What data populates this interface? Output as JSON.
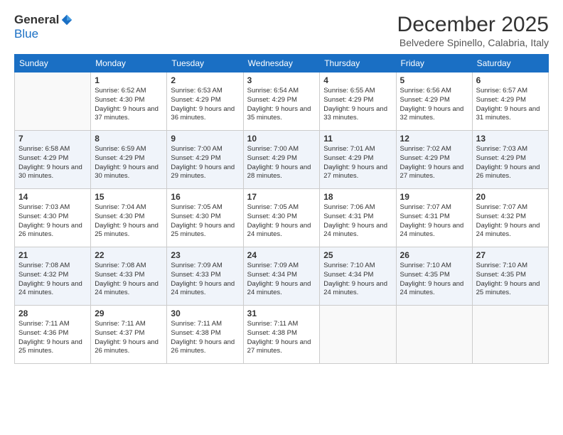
{
  "header": {
    "logo_general": "General",
    "logo_blue": "Blue",
    "month": "December 2025",
    "location": "Belvedere Spinello, Calabria, Italy"
  },
  "weekdays": [
    "Sunday",
    "Monday",
    "Tuesday",
    "Wednesday",
    "Thursday",
    "Friday",
    "Saturday"
  ],
  "weeks": [
    [
      {
        "num": "",
        "sunrise": "",
        "sunset": "",
        "daylight": ""
      },
      {
        "num": "1",
        "sunrise": "Sunrise: 6:52 AM",
        "sunset": "Sunset: 4:30 PM",
        "daylight": "Daylight: 9 hours and 37 minutes."
      },
      {
        "num": "2",
        "sunrise": "Sunrise: 6:53 AM",
        "sunset": "Sunset: 4:29 PM",
        "daylight": "Daylight: 9 hours and 36 minutes."
      },
      {
        "num": "3",
        "sunrise": "Sunrise: 6:54 AM",
        "sunset": "Sunset: 4:29 PM",
        "daylight": "Daylight: 9 hours and 35 minutes."
      },
      {
        "num": "4",
        "sunrise": "Sunrise: 6:55 AM",
        "sunset": "Sunset: 4:29 PM",
        "daylight": "Daylight: 9 hours and 33 minutes."
      },
      {
        "num": "5",
        "sunrise": "Sunrise: 6:56 AM",
        "sunset": "Sunset: 4:29 PM",
        "daylight": "Daylight: 9 hours and 32 minutes."
      },
      {
        "num": "6",
        "sunrise": "Sunrise: 6:57 AM",
        "sunset": "Sunset: 4:29 PM",
        "daylight": "Daylight: 9 hours and 31 minutes."
      }
    ],
    [
      {
        "num": "7",
        "sunrise": "Sunrise: 6:58 AM",
        "sunset": "Sunset: 4:29 PM",
        "daylight": "Daylight: 9 hours and 30 minutes."
      },
      {
        "num": "8",
        "sunrise": "Sunrise: 6:59 AM",
        "sunset": "Sunset: 4:29 PM",
        "daylight": "Daylight: 9 hours and 30 minutes."
      },
      {
        "num": "9",
        "sunrise": "Sunrise: 7:00 AM",
        "sunset": "Sunset: 4:29 PM",
        "daylight": "Daylight: 9 hours and 29 minutes."
      },
      {
        "num": "10",
        "sunrise": "Sunrise: 7:00 AM",
        "sunset": "Sunset: 4:29 PM",
        "daylight": "Daylight: 9 hours and 28 minutes."
      },
      {
        "num": "11",
        "sunrise": "Sunrise: 7:01 AM",
        "sunset": "Sunset: 4:29 PM",
        "daylight": "Daylight: 9 hours and 27 minutes."
      },
      {
        "num": "12",
        "sunrise": "Sunrise: 7:02 AM",
        "sunset": "Sunset: 4:29 PM",
        "daylight": "Daylight: 9 hours and 27 minutes."
      },
      {
        "num": "13",
        "sunrise": "Sunrise: 7:03 AM",
        "sunset": "Sunset: 4:29 PM",
        "daylight": "Daylight: 9 hours and 26 minutes."
      }
    ],
    [
      {
        "num": "14",
        "sunrise": "Sunrise: 7:03 AM",
        "sunset": "Sunset: 4:30 PM",
        "daylight": "Daylight: 9 hours and 26 minutes."
      },
      {
        "num": "15",
        "sunrise": "Sunrise: 7:04 AM",
        "sunset": "Sunset: 4:30 PM",
        "daylight": "Daylight: 9 hours and 25 minutes."
      },
      {
        "num": "16",
        "sunrise": "Sunrise: 7:05 AM",
        "sunset": "Sunset: 4:30 PM",
        "daylight": "Daylight: 9 hours and 25 minutes."
      },
      {
        "num": "17",
        "sunrise": "Sunrise: 7:05 AM",
        "sunset": "Sunset: 4:30 PM",
        "daylight": "Daylight: 9 hours and 24 minutes."
      },
      {
        "num": "18",
        "sunrise": "Sunrise: 7:06 AM",
        "sunset": "Sunset: 4:31 PM",
        "daylight": "Daylight: 9 hours and 24 minutes."
      },
      {
        "num": "19",
        "sunrise": "Sunrise: 7:07 AM",
        "sunset": "Sunset: 4:31 PM",
        "daylight": "Daylight: 9 hours and 24 minutes."
      },
      {
        "num": "20",
        "sunrise": "Sunrise: 7:07 AM",
        "sunset": "Sunset: 4:32 PM",
        "daylight": "Daylight: 9 hours and 24 minutes."
      }
    ],
    [
      {
        "num": "21",
        "sunrise": "Sunrise: 7:08 AM",
        "sunset": "Sunset: 4:32 PM",
        "daylight": "Daylight: 9 hours and 24 minutes."
      },
      {
        "num": "22",
        "sunrise": "Sunrise: 7:08 AM",
        "sunset": "Sunset: 4:33 PM",
        "daylight": "Daylight: 9 hours and 24 minutes."
      },
      {
        "num": "23",
        "sunrise": "Sunrise: 7:09 AM",
        "sunset": "Sunset: 4:33 PM",
        "daylight": "Daylight: 9 hours and 24 minutes."
      },
      {
        "num": "24",
        "sunrise": "Sunrise: 7:09 AM",
        "sunset": "Sunset: 4:34 PM",
        "daylight": "Daylight: 9 hours and 24 minutes."
      },
      {
        "num": "25",
        "sunrise": "Sunrise: 7:10 AM",
        "sunset": "Sunset: 4:34 PM",
        "daylight": "Daylight: 9 hours and 24 minutes."
      },
      {
        "num": "26",
        "sunrise": "Sunrise: 7:10 AM",
        "sunset": "Sunset: 4:35 PM",
        "daylight": "Daylight: 9 hours and 24 minutes."
      },
      {
        "num": "27",
        "sunrise": "Sunrise: 7:10 AM",
        "sunset": "Sunset: 4:35 PM",
        "daylight": "Daylight: 9 hours and 25 minutes."
      }
    ],
    [
      {
        "num": "28",
        "sunrise": "Sunrise: 7:11 AM",
        "sunset": "Sunset: 4:36 PM",
        "daylight": "Daylight: 9 hours and 25 minutes."
      },
      {
        "num": "29",
        "sunrise": "Sunrise: 7:11 AM",
        "sunset": "Sunset: 4:37 PM",
        "daylight": "Daylight: 9 hours and 26 minutes."
      },
      {
        "num": "30",
        "sunrise": "Sunrise: 7:11 AM",
        "sunset": "Sunset: 4:38 PM",
        "daylight": "Daylight: 9 hours and 26 minutes."
      },
      {
        "num": "31",
        "sunrise": "Sunrise: 7:11 AM",
        "sunset": "Sunset: 4:38 PM",
        "daylight": "Daylight: 9 hours and 27 minutes."
      },
      {
        "num": "",
        "sunrise": "",
        "sunset": "",
        "daylight": ""
      },
      {
        "num": "",
        "sunrise": "",
        "sunset": "",
        "daylight": ""
      },
      {
        "num": "",
        "sunrise": "",
        "sunset": "",
        "daylight": ""
      }
    ]
  ]
}
